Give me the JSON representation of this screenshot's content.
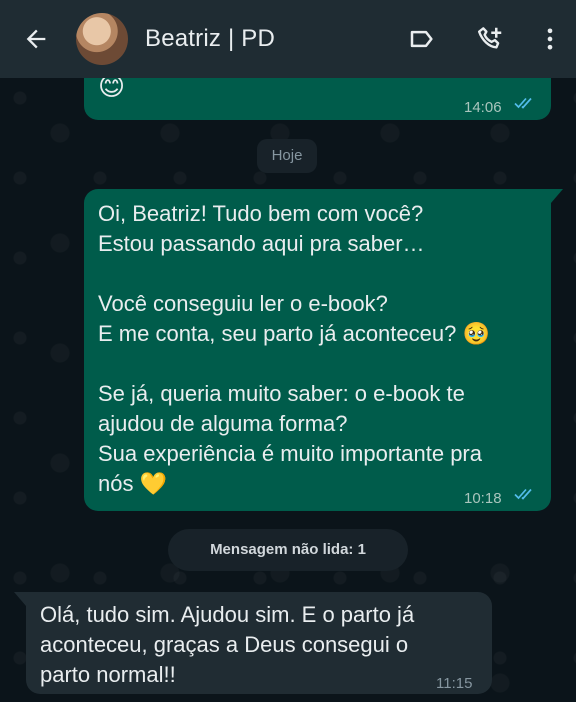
{
  "header": {
    "contact_name": "Beatriz | PD",
    "icons": [
      "back-arrow-icon",
      "avatar",
      "label-icon",
      "add-call-icon",
      "more-vert-icon"
    ]
  },
  "messages": [
    {
      "direction": "out",
      "emoji": "😊",
      "time": "14:06",
      "status": "read"
    },
    {
      "direction": "out",
      "lines": [
        "Oi, Beatriz! Tudo bem com você?",
        "Estou passando aqui pra saber…",
        "",
        "Você conseguiu ler o e-book?",
        "E me conta, seu parto já aconteceu? 🥹",
        "",
        "Se já, queria muito saber: o e-book te",
        "ajudou de alguma forma?",
        "Sua experiência é muito importante pra",
        "nós 💛"
      ],
      "time": "10:18",
      "status": "read"
    },
    {
      "direction": "in",
      "lines": [
        "Olá, tudo sim. Ajudou sim. E  o parto já",
        "aconteceu, graças a Deus consegui o",
        "parto normal!!"
      ],
      "time": "11:15"
    }
  ],
  "date_divider": "Hoje",
  "unread_divider": "Mensagem não lida: 1",
  "colors": {
    "header_bg": "#1f2c33",
    "chat_bg": "#0b141a",
    "outgoing_bubble": "#005c4b",
    "incoming_bubble": "#202c33",
    "read_ticks": "#53bdeb"
  }
}
